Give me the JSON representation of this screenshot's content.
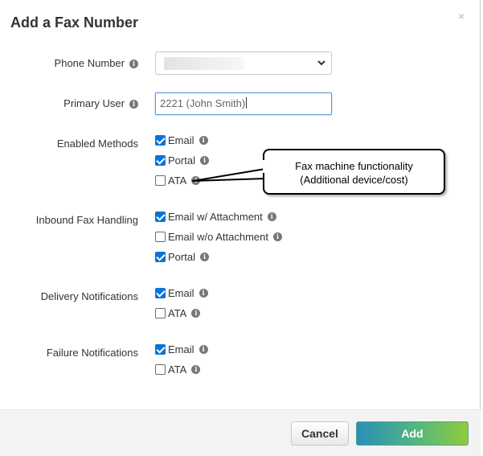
{
  "dialog": {
    "title": "Add a Fax Number",
    "close_glyph": "×"
  },
  "fields": {
    "phone_number_label": "Phone Number",
    "primary_user_label": "Primary User",
    "primary_user_value": "2221 (John Smith)",
    "enabled_methods_label": "Enabled Methods",
    "inbound_label": "Inbound Fax Handling",
    "delivery_label": "Delivery Notifications",
    "failure_label": "Failure Notifications"
  },
  "enabled_methods": [
    {
      "label": "Email",
      "checked": true
    },
    {
      "label": "Portal",
      "checked": true
    },
    {
      "label": "ATA",
      "checked": false
    }
  ],
  "inbound": [
    {
      "label": "Email w/ Attachment",
      "checked": true
    },
    {
      "label": "Email w/o Attachment",
      "checked": false
    },
    {
      "label": "Portal",
      "checked": true
    }
  ],
  "delivery": [
    {
      "label": "Email",
      "checked": true
    },
    {
      "label": "ATA",
      "checked": false
    }
  ],
  "failure": [
    {
      "label": "Email",
      "checked": true
    },
    {
      "label": "ATA",
      "checked": false
    }
  ],
  "callout": {
    "line1": "Fax machine functionality",
    "line2": "(Additional device/cost)"
  },
  "footer": {
    "cancel_label": "Cancel",
    "add_label": "Add"
  },
  "icons": {
    "info": "i",
    "close": "close-icon",
    "chevron": "chevron-down-icon"
  },
  "colors": {
    "checkbox_on": "#0a74d8",
    "add_gradient_start": "#2a8fb8",
    "add_gradient_end": "#8fcb3c",
    "input_focus": "#5b9bd5"
  }
}
